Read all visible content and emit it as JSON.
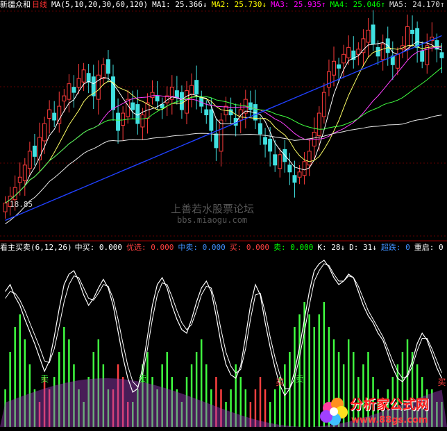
{
  "main_header": {
    "stock_name": "新疆众和",
    "period": "日线",
    "ma_params": "MA(5,10,20,30,60,120)",
    "ma_values": [
      {
        "label": "MA1:",
        "value": "25.366",
        "arrow": "↓",
        "color": "#ffffff"
      },
      {
        "label": "MA2:",
        "value": "25.730",
        "arrow": "↓",
        "color": "#ffff00"
      },
      {
        "label": "MA3:",
        "value": "25.935",
        "arrow": "↑",
        "color": "#ff00ff"
      },
      {
        "label": "MA4:",
        "value": "25.046",
        "arrow": "↑",
        "color": "#00ff00"
      },
      {
        "label": "MA5:",
        "value": "24.170",
        "arrow": "↑",
        "color": "#dddddd"
      }
    ]
  },
  "indicator_header": {
    "name": "看主买卖(6,12,26)",
    "items": [
      {
        "label": "中买:",
        "value": "0.000",
        "color": "#ffffff"
      },
      {
        "label": "优选:",
        "value": "0.000",
        "color": "#ff4040"
      },
      {
        "label": "中卖:",
        "value": "0.000",
        "color": "#4090ff"
      },
      {
        "label": "买:",
        "value": "0.000",
        "color": "#ff4040"
      },
      {
        "label": "卖:",
        "value": "0.000",
        "color": "#00ff00"
      },
      {
        "label": "K:",
        "value": "28",
        "arrow": "↓",
        "color": "#ffffff"
      },
      {
        "label": "D:",
        "value": "31",
        "arrow": "↓",
        "color": "#ffffff"
      },
      {
        "label": "超跌:",
        "value": "0",
        "color": "#4090ff"
      },
      {
        "label": "重启:",
        "value": "0",
        "color": "#ffffff"
      }
    ]
  },
  "low_price_label": "18.85",
  "watermark": {
    "line1": "上善若水股票论坛",
    "line2": "bbs.miaogu.com"
  },
  "logo": {
    "text": "分析家公式网",
    "url": "www.88gs.com"
  },
  "signal_labels": {
    "sell": "卖",
    "buy": "买"
  },
  "colors": {
    "up": "#ff3b3b",
    "down": "#40e0e0",
    "ma1": "#ffffff",
    "ma2": "#ffff66",
    "ma3": "#ff40ff",
    "ma4": "#40ff40",
    "ma5": "#e8e8e8",
    "ma6": "#2040ff",
    "k": "#ffffff",
    "d": "#ffffff",
    "vol_pos": "#40ff40",
    "vol_neg": "#ff4040",
    "area": "#a040c0",
    "grid": "#600000"
  },
  "chart_data": {
    "type": "candlestick",
    "note_ylim_price": [
      17.5,
      30.5
    ],
    "ylim": [
      17.5,
      30.5
    ],
    "candles_close": [
      19.4,
      19.8,
      20.3,
      20.9,
      21.6,
      22.4,
      22.1,
      23.2,
      24.0,
      24.8,
      24.2,
      25.0,
      25.6,
      26.3,
      25.8,
      26.6,
      27.1,
      26.4,
      25.6,
      26.8,
      27.4,
      26.9,
      24.8,
      23.6,
      24.6,
      25.4,
      24.8,
      24.0,
      24.5,
      25.2,
      25.8,
      25.3,
      24.9,
      25.6,
      26.1,
      25.5,
      24.8,
      25.9,
      26.2,
      25.7,
      25.0,
      24.5,
      23.6,
      22.6,
      24.2,
      25.0,
      24.5,
      23.9,
      24.8,
      25.4,
      24.8,
      24.2,
      23.4,
      22.8,
      22.4,
      21.6,
      22.2,
      21.8,
      21.2,
      20.6,
      21.2,
      21.8,
      22.4,
      23.5,
      24.6,
      25.8,
      27.0,
      27.6,
      27.2,
      28.0,
      28.4,
      27.7,
      28.3,
      28.9,
      29.4,
      28.6,
      27.9,
      28.6,
      28.1,
      27.4,
      28.0,
      28.5,
      29.6,
      29.2,
      28.4,
      27.6,
      28.5,
      29.0,
      28.3,
      27.8
    ],
    "k_values": [
      78,
      82,
      75,
      70,
      62,
      55,
      48,
      40,
      32,
      38,
      52,
      68,
      82,
      88,
      90,
      84,
      76,
      70,
      74,
      80,
      85,
      80,
      70,
      55,
      40,
      28,
      20,
      22,
      34,
      52,
      70,
      82,
      86,
      80,
      70,
      62,
      56,
      54,
      62,
      72,
      80,
      84,
      78,
      64,
      48,
      36,
      30,
      28,
      35,
      52,
      70,
      82,
      76,
      60,
      46,
      34,
      24,
      18,
      22,
      32,
      46,
      62,
      78,
      90,
      94,
      96,
      92,
      86,
      82,
      84,
      88,
      86,
      78,
      70,
      64,
      60,
      54,
      50,
      42,
      34,
      28,
      26,
      30,
      38,
      48,
      54,
      50,
      42,
      34,
      28
    ],
    "d_values": [
      74,
      78,
      77,
      73,
      67,
      60,
      53,
      46,
      38,
      37,
      45,
      58,
      72,
      82,
      87,
      86,
      80,
      74,
      73,
      77,
      82,
      81,
      74,
      62,
      48,
      35,
      26,
      23,
      30,
      45,
      62,
      76,
      83,
      82,
      75,
      67,
      60,
      56,
      59,
      67,
      76,
      81,
      80,
      70,
      56,
      43,
      35,
      31,
      33,
      45,
      62,
      76,
      77,
      66,
      52,
      40,
      30,
      22,
      22,
      28,
      40,
      55,
      70,
      84,
      90,
      94,
      93,
      88,
      84,
      84,
      87,
      86,
      81,
      74,
      67,
      62,
      57,
      52,
      45,
      38,
      32,
      28,
      29,
      35,
      44,
      51,
      51,
      45,
      38,
      31
    ],
    "vol_values": [
      0.3,
      0.6,
      0.8,
      0.9,
      0.7,
      0.5,
      0.3,
      -0.2,
      -0.4,
      -0.3,
      0.4,
      0.6,
      0.8,
      0.7,
      0.5,
      0.3,
      0.2,
      0.4,
      0.6,
      0.7,
      0.5,
      0.3,
      -0.3,
      -0.5,
      -0.4,
      -0.2,
      0.2,
      0.3,
      0.5,
      0.6,
      0.4,
      0.3,
      0.5,
      0.6,
      0.4,
      0.3,
      0.2,
      0.4,
      0.5,
      0.6,
      0.7,
      0.5,
      0.3,
      -0.4,
      -0.3,
      0.2,
      0.3,
      0.5,
      0.4,
      0.3,
      -0.2,
      -0.3,
      -0.4,
      -0.3,
      0.2,
      0.3,
      0.4,
      0.5,
      0.6,
      0.8,
      0.9,
      1.0,
      0.9,
      0.8,
      0.9,
      1.0,
      0.8,
      0.7,
      0.6,
      0.5,
      0.7,
      0.6,
      0.4,
      0.5,
      0.6,
      0.4,
      0.3,
      0.2,
      0.3,
      0.4,
      0.5,
      0.6,
      0.7,
      0.6,
      0.5,
      0.4,
      0.3,
      0.3,
      0.2,
      0.2
    ],
    "sell_signals": [
      8,
      28,
      60
    ],
    "buy_signals": [
      56,
      101
    ]
  }
}
